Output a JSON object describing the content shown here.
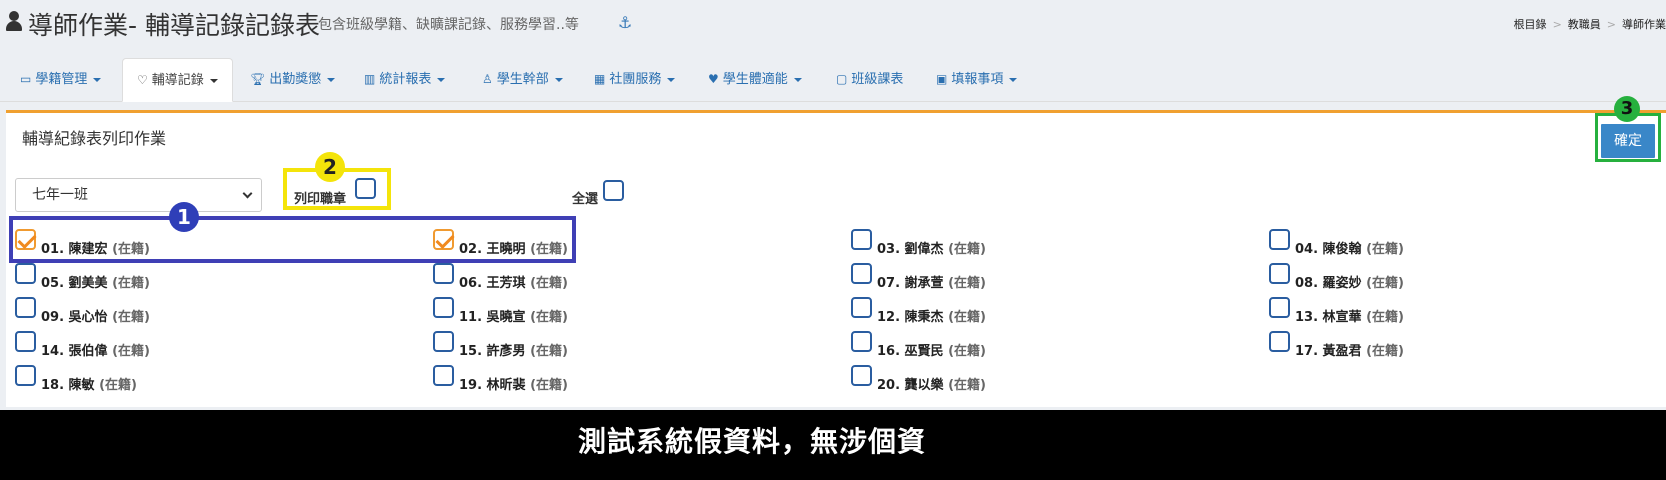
{
  "header": {
    "title": "導師作業- 輔導記錄記錄表",
    "subtitle": "包含班級學籍、缺曠課記錄、服務學習..等",
    "breadcrumb": [
      "根目錄",
      "教職員",
      "導師作業"
    ]
  },
  "nav": [
    {
      "label": "學籍管理",
      "icon": "id-card-icon",
      "dropdown": true,
      "active": false
    },
    {
      "label": "輔導記錄",
      "icon": "heart-icon",
      "dropdown": true,
      "active": true
    },
    {
      "label": "出勤獎懲",
      "icon": "trophy-icon",
      "dropdown": true,
      "active": false
    },
    {
      "label": "統計報表",
      "icon": "bar-chart-icon",
      "dropdown": true,
      "active": false
    },
    {
      "label": "學生幹部",
      "icon": "person-icon",
      "dropdown": true,
      "active": false
    },
    {
      "label": "社團服務",
      "icon": "group-icon",
      "dropdown": true,
      "active": false
    },
    {
      "label": "學生體適能",
      "icon": "heartbeat-icon",
      "dropdown": true,
      "active": false
    },
    {
      "label": "班級課表",
      "icon": "calendar-icon",
      "dropdown": false,
      "active": false
    },
    {
      "label": "填報事項",
      "icon": "form-icon",
      "dropdown": true,
      "active": false
    }
  ],
  "panel": {
    "title": "輔導紀錄表列印作業",
    "confirm_label": "確定",
    "class_select_value": "七年一班",
    "print_stamp_label": "列印職章",
    "select_all_label": "全選"
  },
  "students": [
    {
      "label": "01. 陳建宏",
      "status": "(在籍)",
      "checked": true
    },
    {
      "label": "02. 王曉明",
      "status": "(在籍)",
      "checked": true
    },
    {
      "label": "03. 劉偉杰",
      "status": "(在籍)",
      "checked": false
    },
    {
      "label": "04. 陳俊翰",
      "status": "(在籍)",
      "checked": false
    },
    {
      "label": "05. 劉美美",
      "status": "(在籍)",
      "checked": false
    },
    {
      "label": "06. 王芳琪",
      "status": "(在籍)",
      "checked": false
    },
    {
      "label": "07. 謝承萱",
      "status": "(在籍)",
      "checked": false
    },
    {
      "label": "08. 羅姿妙",
      "status": "(在籍)",
      "checked": false
    },
    {
      "label": "09. 吳心怡",
      "status": "(在籍)",
      "checked": false
    },
    {
      "label": "11. 吳曉宣",
      "status": "(在籍)",
      "checked": false
    },
    {
      "label": "12. 陳秉杰",
      "status": "(在籍)",
      "checked": false
    },
    {
      "label": "13. 林宣華",
      "status": "(在籍)",
      "checked": false
    },
    {
      "label": "14. 張伯偉",
      "status": "(在籍)",
      "checked": false
    },
    {
      "label": "15. 許彥男",
      "status": "(在籍)",
      "checked": false
    },
    {
      "label": "16. 巫賢民",
      "status": "(在籍)",
      "checked": false
    },
    {
      "label": "17. 黃盈君",
      "status": "(在籍)",
      "checked": false
    },
    {
      "label": "18. 陳敏",
      "status": "(在籍)",
      "checked": false
    },
    {
      "label": "19. 林昕裴",
      "status": "(在籍)",
      "checked": false
    },
    {
      "label": "20. 龔以樂",
      "status": "(在籍)",
      "checked": false
    }
  ],
  "annotations": {
    "badge_1": "1",
    "badge_2": "2",
    "badge_3": "3"
  },
  "caption": "測試系統假資料，無涉個資",
  "colors": {
    "accent_orange": "#f0a030",
    "confirm_blue": "#3a87c8",
    "highlight_blue": "#3f3fb5",
    "highlight_yellow": "#f4e40a",
    "highlight_green": "#26b03e"
  }
}
